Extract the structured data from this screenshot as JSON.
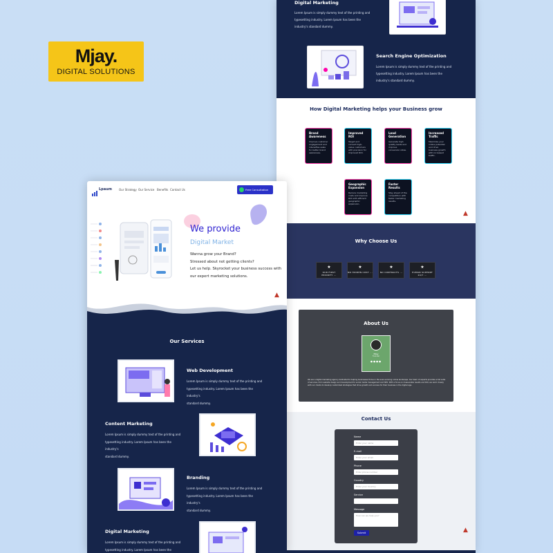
{
  "brand": {
    "name": "Mjay.",
    "tagline": "DIGITAL SOLUTIONS"
  },
  "colors": {
    "navy": "#16254a",
    "accent": "#4b3bdc",
    "badge": "#f5c518",
    "why_bg": "#2a3560"
  },
  "right_page": {
    "top_service": {
      "title": "Digital Marketing",
      "text": "Lorem Ipsum is simply dummy text of the printing and typesetting industry. Lorem Ipsum has been the industry's standard dummy."
    },
    "seo": {
      "title": "Search Engine Optimization",
      "text": "Lorem Ipsum is simply dummy text of the printing and typesetting industry. Lorem Ipsum has been the industry's standard dummy."
    },
    "helps": {
      "title": "How Digital Marketing helps your Business grow",
      "cards": [
        {
          "title": "Brand Awareness",
          "text": "Improve customer engagement and intensifies sales for better brand awareness."
        },
        {
          "title": "Improved ROI",
          "text": "Target and convert high-value customers with precision for improved ROI."
        },
        {
          "title": "Lead Generation",
          "text": "Generate high quality leads and improve conversion rates."
        },
        {
          "title": "Increased Traffic",
          "text": "Maximize your online potential and drive business growth with increased traffic."
        },
        {
          "title": "Geographic Expansion",
          "text": "Reduce marketing costs and improve ROI with efficient geographic expansion."
        },
        {
          "title": "Faster Results",
          "text": "Stay ahead of the competition with faster marketing results."
        }
      ]
    },
    "why": {
      "title": "Why Choose Us",
      "items": [
        "OUR FIRST PRIORITY ...",
        "NO HIDDEN COST ...",
        "NO CONTRACTS ...",
        "HUMAN SUPPORT 24/7 ..."
      ]
    },
    "about": {
      "title": "About Us",
      "name": "Mjay",
      "role": "Founder",
      "text": "We are a digital marketing agency dedicated to helping businesses thrive in the ever-evolving online landscape. Our team of experts provides a full suite of services, from website design and development to social media management and SEO. With a focus on measurable results and ROI, we work closely with our clients to develop customized strategies that drive growth and success for their business in the digital age."
    },
    "contact": {
      "title": "Contact Us",
      "fields": [
        {
          "label": "Name",
          "placeholder": "Enter your name"
        },
        {
          "label": "E-mail",
          "placeholder": "Enter your email"
        },
        {
          "label": "Phone",
          "placeholder": "Enter phone number"
        },
        {
          "label": "Country",
          "placeholder": "Enter your Country"
        },
        {
          "label": "Service",
          "placeholder": ""
        }
      ],
      "message_label": "Message",
      "message_placeholder": "How can we help you?",
      "submit": "Submit"
    }
  },
  "left_page": {
    "logo": "Lpaum",
    "nav": [
      "Our Strategy",
      "Our Service",
      "Benefits",
      "Contact Us"
    ],
    "cta": "Free Consultation Call",
    "hero": {
      "line1": "We provide",
      "line2": "Digital Market",
      "body": [
        "Wanna grow your Brand?",
        "Stressed about not getting clients?",
        "Let us help. Skyrocket your business success with",
        "our expert marketing solutions."
      ]
    },
    "services_title": "Our Services",
    "services": [
      {
        "title": "Web Development",
        "text": [
          "Lorem Ipsum is simply dummy text of the printing and",
          "typesetting industry. Lorem Ipsum has been the industry's",
          "standard dummy."
        ]
      },
      {
        "title": "Content Marketing",
        "text": [
          "Lorem Ipsum is simply dummy text of the printing and",
          "typesetting industry. Lorem Ipsum has been the industry's",
          "standard dummy."
        ]
      },
      {
        "title": "Branding",
        "text": [
          "Lorem Ipsum is simply dummy text of the printing and",
          "typesetting industry. Lorem Ipsum has been the industry's",
          "standard dummy."
        ]
      },
      {
        "title": "Digital Marketing",
        "text": [
          "Lorem Ipsum is simply dummy text of the printing and",
          "typesetting industry. Lorem Ipsum has been the industry's"
        ]
      }
    ]
  }
}
